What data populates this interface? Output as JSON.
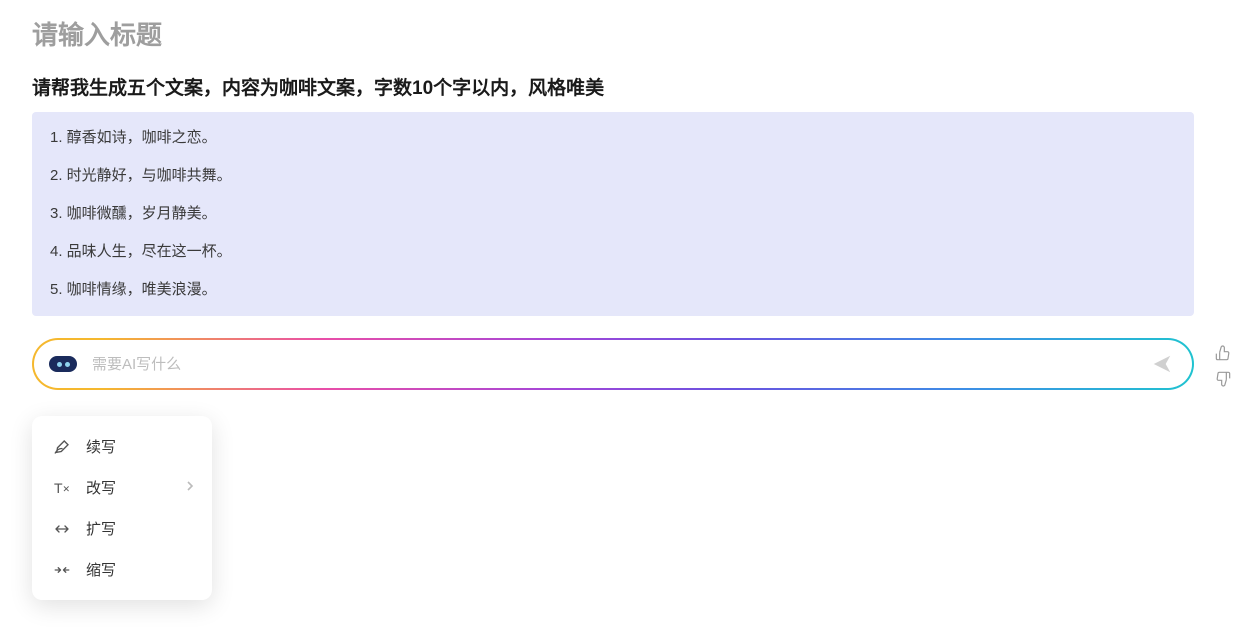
{
  "title": {
    "placeholder": "请输入标题"
  },
  "prompt": "请帮我生成五个文案，内容为咖啡文案，字数10个字以内，风格唯美",
  "response": {
    "lines": [
      "1. 醇香如诗，咖啡之恋。",
      "2. 时光静好，与咖啡共舞。",
      "3. 咖啡微醺，岁月静美。",
      "4. 品味人生，尽在这一杯。",
      "5. 咖啡情缘，唯美浪漫。"
    ]
  },
  "chat": {
    "placeholder": "需要AI写什么"
  },
  "dropdown": {
    "items": [
      {
        "label": "续写",
        "has_submenu": false
      },
      {
        "label": "改写",
        "has_submenu": true
      },
      {
        "label": "扩写",
        "has_submenu": false
      },
      {
        "label": "缩写",
        "has_submenu": false
      }
    ]
  }
}
